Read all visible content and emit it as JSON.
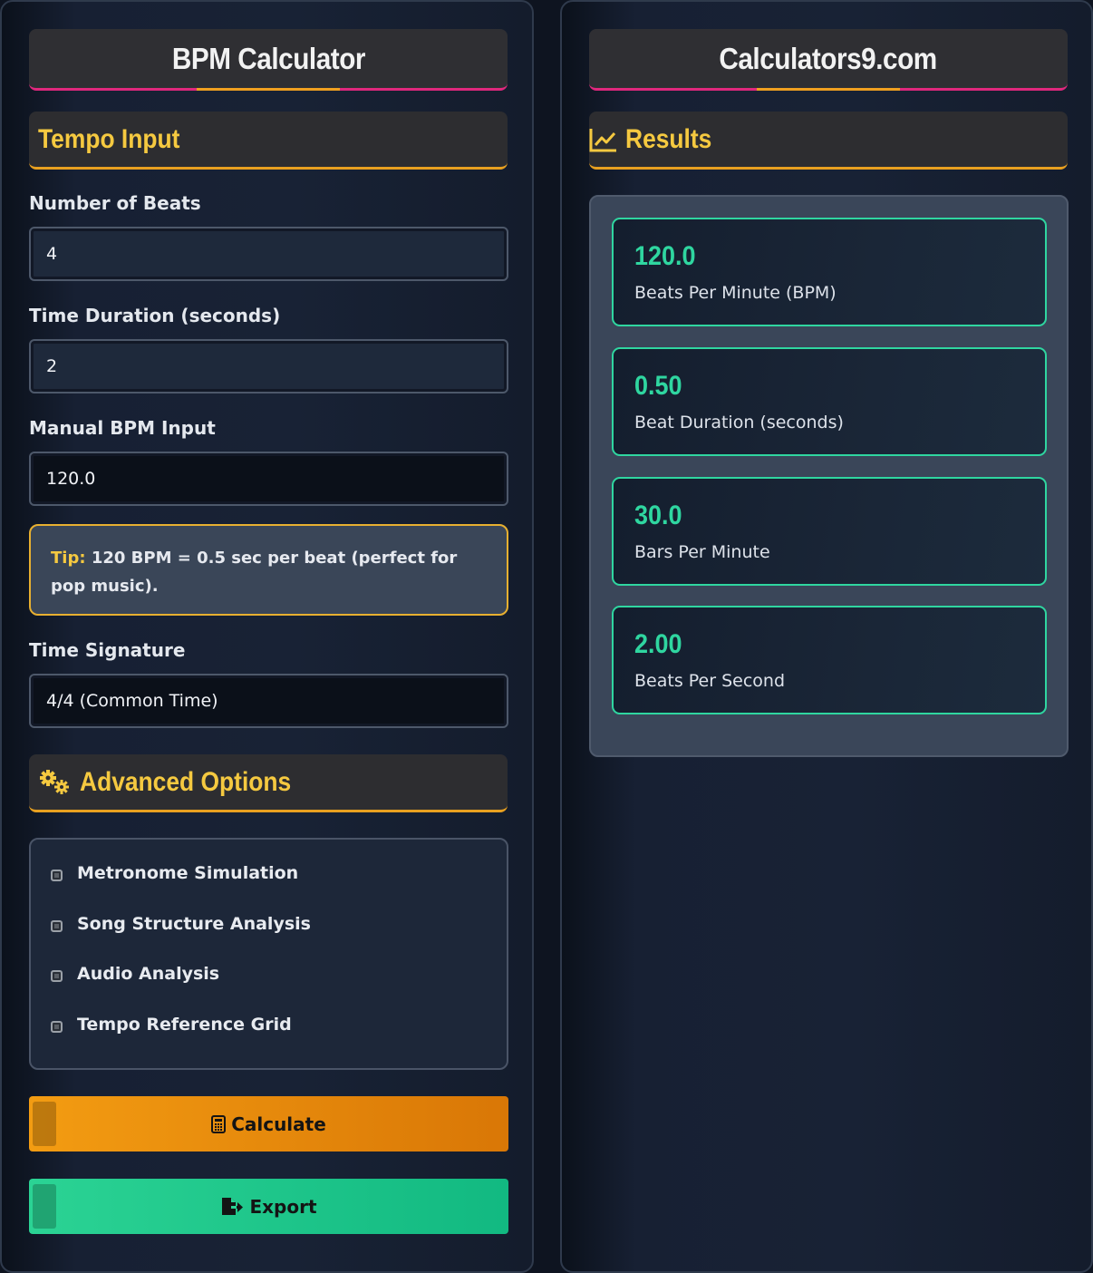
{
  "left_panel": {
    "title": "BPM Calculator",
    "tempo_section": {
      "title": "Tempo Input",
      "fields": [
        {
          "label": "Number of Beats",
          "value": "4"
        },
        {
          "label": "Time Duration (seconds)",
          "value": "2"
        },
        {
          "label": "Manual BPM Input",
          "value": "120.0"
        }
      ],
      "tip": {
        "key": "Tip:",
        "text": "120 BPM = 0.5 sec per beat (perfect for pop music)."
      },
      "time_signature": {
        "label": "Time Signature",
        "selected": "4/4 (Common Time)"
      }
    },
    "advanced_section": {
      "title": "Advanced Options",
      "icon": "gears-icon",
      "options": [
        {
          "label": "Metronome Simulation",
          "checked": false
        },
        {
          "label": "Song Structure Analysis",
          "checked": false
        },
        {
          "label": "Audio Analysis",
          "checked": false
        },
        {
          "label": "Tempo Reference Grid",
          "checked": false
        }
      ]
    },
    "buttons": {
      "calculate_label": "Calculate",
      "calculate_icon": "calculator-icon",
      "export_label": "Export",
      "export_icon": "file-export-icon"
    }
  },
  "right_panel": {
    "title": "Calculators9.com",
    "results_section": {
      "title": "Results",
      "icon": "line-chart-icon",
      "cards": [
        {
          "value": "120.0",
          "label": "Beats Per Minute (BPM)"
        },
        {
          "value": "0.50",
          "label": "Beat Duration (seconds)"
        },
        {
          "value": "30.0",
          "label": "Bars Per Minute"
        },
        {
          "value": "2.00",
          "label": "Beats Per Second"
        }
      ]
    }
  },
  "colors": {
    "accent_gold": "#f5c940",
    "accent_pink": "#e0287d",
    "accent_orange": "#f39c12",
    "accent_green": "#2fd6a0"
  }
}
